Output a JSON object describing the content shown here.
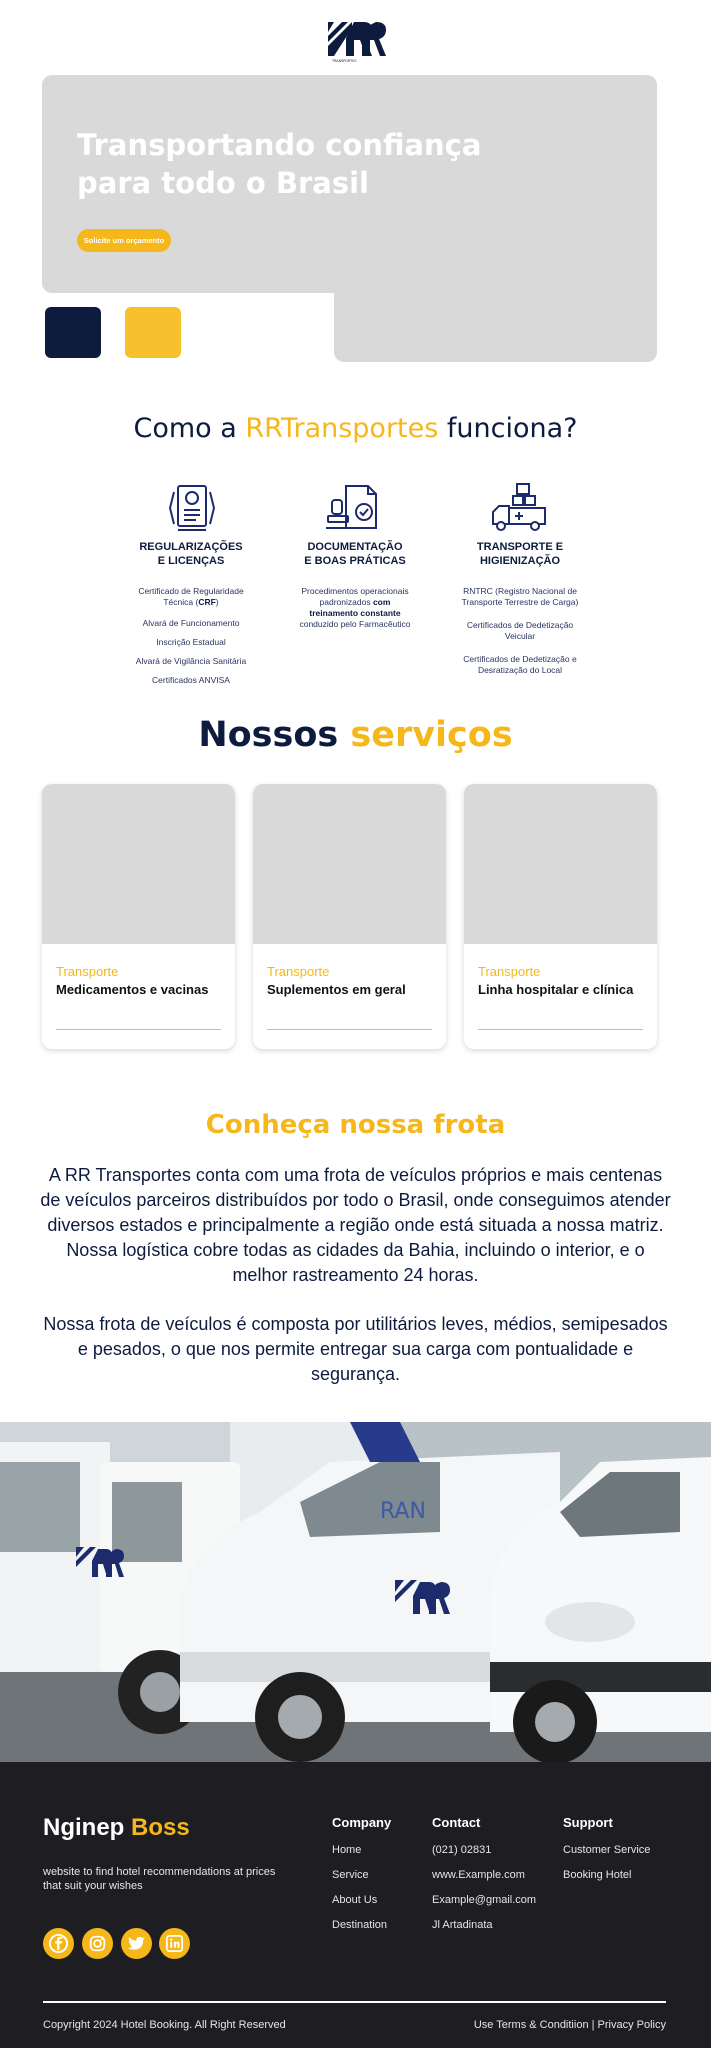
{
  "colors": {
    "navy": "#0d1b3e",
    "accent": "#f6b71a",
    "footer_bg": "#1d1d22",
    "placeholder": "#d9d9d9"
  },
  "header": {
    "logo_icon": "rr-logo-icon",
    "logo_caption": "TRANSPORTES"
  },
  "hero": {
    "title_line1": "Transportando confiança",
    "title_line2": "para todo o Brasil",
    "cta_label": "Solicite um orçamento"
  },
  "how": {
    "title_prefix": "Como a ",
    "title_brand": "RRTransportes",
    "title_suffix": " funciona?",
    "columns": [
      {
        "icon": "certificate-icon",
        "heading_line1": "REGULARIZAÇÕES",
        "heading_line2": "E LICENÇAS",
        "items": [
          {
            "text_a": "Certificado de Regularidade",
            "text_b": "Técnica (",
            "bold": "CRF",
            "text_c": ")"
          },
          {
            "text": "Alvará de Funcionamento"
          },
          {
            "text": "Inscrição Estadual"
          },
          {
            "text": "Alvará de Vigilância Sanitária"
          },
          {
            "text": "Certificados ANVISA"
          }
        ]
      },
      {
        "icon": "document-stamp-icon",
        "heading_line1": "DOCUMENTAÇÃO",
        "heading_line2": "E BOAS PRÁTICAS",
        "items": [
          {
            "line1": "Procedimentos operacionais",
            "line2a": "padronizados ",
            "line2b": "com",
            "line3": "treinamento constante",
            "line4": "conduzido pelo Farmacêutico"
          }
        ]
      },
      {
        "icon": "delivery-truck-icon",
        "heading_line1": "TRANSPORTE E",
        "heading_line2": "HIGIENIZAÇÃO",
        "items": [
          {
            "line1": "RNTRC (Registro Nacional de",
            "line2": "Transporte Terrestre de Carga)"
          },
          {
            "line1": "Certificados de Dedetização",
            "line2": "Veicular"
          },
          {
            "line1": "Certificados de Dedetização e",
            "line2": "Desratização do Local"
          }
        ]
      }
    ]
  },
  "services": {
    "title_main": "Nossos ",
    "title_accent": "serviços",
    "cards": [
      {
        "category": "Transporte",
        "name": "Medicamentos e vacinas"
      },
      {
        "category": "Transporte",
        "name": "Suplementos em geral"
      },
      {
        "category": "Transporte",
        "name": "Linha hospitalar e clínica"
      }
    ]
  },
  "fleet": {
    "title": "Conheça nossa frota",
    "p1": "A RR Transportes conta com uma frota de veículos próprios e mais centenas de veículos parceiros distribuídos por todo  o Brasil, onde conseguimos atender diversos estados e principalmente a região onde está situada a nossa matriz. Nossa logística cobre todas as cidades  da Bahia, incluindo o interior, e o melhor rastreamento 24 horas.",
    "p2": "Nossa frota de veículos é composta por utilitários leves, médios, semipesados e pesados, o que nos permite entregar sua carga com pontualidade e segurança.",
    "van_text": "RAN"
  },
  "footer": {
    "brand_main": "Nginep ",
    "brand_accent": "Boss",
    "tagline": "website to find hotel recommendations at prices that suit your wishes",
    "socials": [
      "facebook-icon",
      "instagram-icon",
      "twitter-icon",
      "linkedin-icon"
    ],
    "company": {
      "heading": "Company",
      "links": [
        "Home",
        "Service",
        "About Us",
        "Destination"
      ]
    },
    "contact": {
      "heading": "Contact",
      "links": [
        "(021) 02831",
        "www.Example.com",
        "Example@gmail.com",
        "Jl Artadinata"
      ]
    },
    "support": {
      "heading": "Support",
      "links": [
        "Customer Service",
        "Booking Hotel"
      ]
    },
    "copyright": "Copyright 2024 Hotel Booking. All Right Reserved",
    "terms": "Use Terms & Conditiion | Privacy Policy"
  }
}
